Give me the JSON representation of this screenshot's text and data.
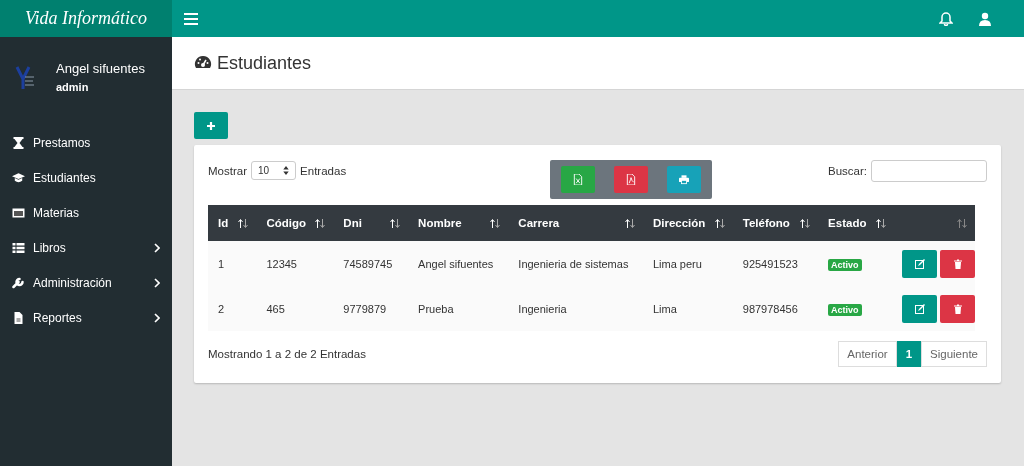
{
  "brand": "Vida Informático",
  "user": {
    "name": "Angel sifuentes",
    "role": "admin"
  },
  "sidebar": {
    "items": [
      {
        "label": "Prestamos",
        "has_submenu": false
      },
      {
        "label": "Estudiantes",
        "has_submenu": false
      },
      {
        "label": "Materias",
        "has_submenu": false
      },
      {
        "label": "Libros",
        "has_submenu": true
      },
      {
        "label": "Administración",
        "has_submenu": true
      },
      {
        "label": "Reportes",
        "has_submenu": true
      }
    ]
  },
  "page_title": "Estudiantes",
  "table_controls": {
    "show_label": "Mostrar",
    "page_size": "10",
    "entries_label": "Entradas",
    "search_label": "Buscar:"
  },
  "table": {
    "columns": [
      "Id",
      "Código",
      "Dni",
      "Nombre",
      "Carrera",
      "Dirección",
      "Teléfono",
      "Estado"
    ],
    "rows": [
      {
        "cells": [
          "1",
          "12345",
          "74589745",
          "Angel sifuentes",
          "Ingenieria de sistemas",
          "Lima peru",
          "925491523"
        ],
        "status": "Activo"
      },
      {
        "cells": [
          "2",
          "465",
          "9779879",
          "Prueba",
          "Ingenieria",
          "Lima",
          "987978456"
        ],
        "status": "Activo"
      }
    ]
  },
  "footer": {
    "summary": "Mostrando 1 a 2 de 2 Entradas",
    "pagination": [
      {
        "label": "Anterior",
        "selected": false
      },
      {
        "label": "1",
        "selected": true
      },
      {
        "label": "Siguiente",
        "selected": false
      }
    ]
  }
}
